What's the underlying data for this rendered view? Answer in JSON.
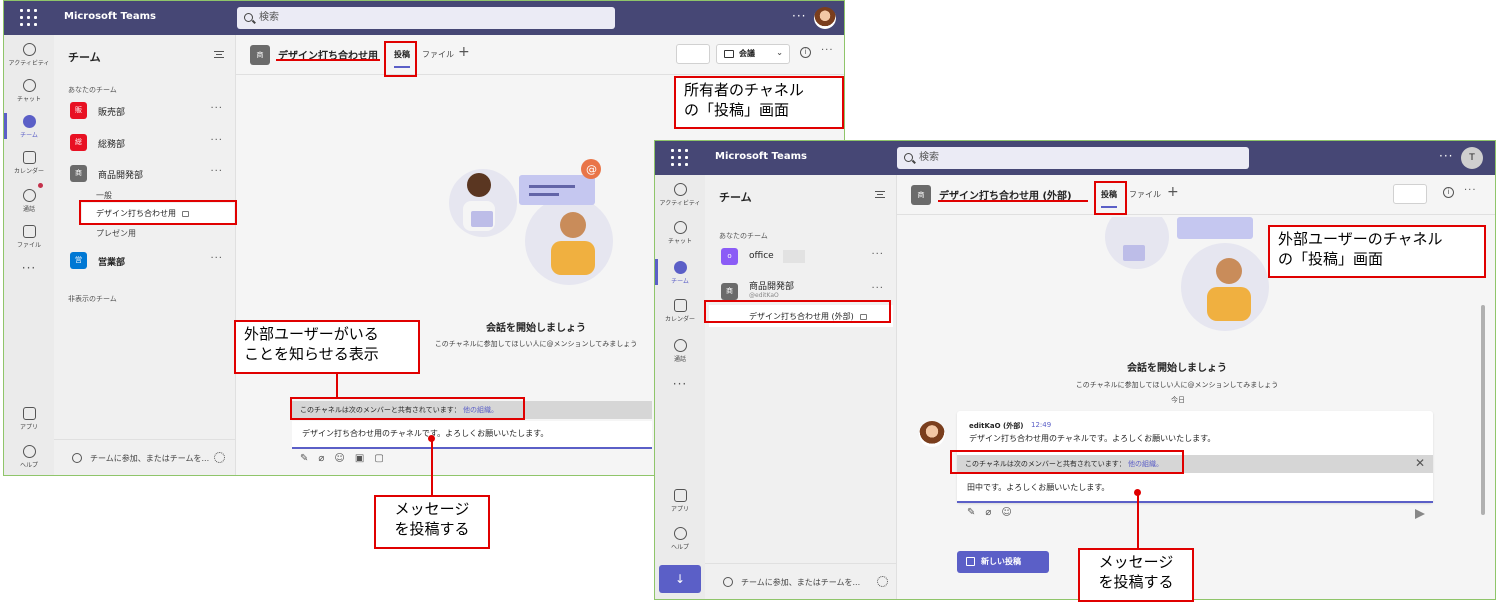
{
  "colors": {
    "titlebar": "#464775",
    "accent": "#5b5fc7",
    "callout_border": "#e00000",
    "window_border": "#8fc56a"
  },
  "win1": {
    "app_name": "Microsoft Teams",
    "search_placeholder": "検索",
    "more": "···",
    "rail": [
      {
        "label": "アクティビティ",
        "icon": "bell-icon"
      },
      {
        "label": "チャット",
        "icon": "chat-icon"
      },
      {
        "label": "チーム",
        "icon": "teams-icon"
      },
      {
        "label": "カレンダー",
        "icon": "calendar-icon"
      },
      {
        "label": "通話",
        "icon": "phone-icon"
      },
      {
        "label": "ファイル",
        "icon": "file-icon"
      },
      {
        "label": "···",
        "icon": "more-icon"
      },
      {
        "label": "アプリ",
        "icon": "apps-icon"
      },
      {
        "label": "ヘルプ",
        "icon": "help-icon"
      }
    ],
    "panel_title": "チーム",
    "your_teams_label": "あなたのチーム",
    "teams": [
      {
        "tile": "販",
        "name": "販売部",
        "color": "#e81123"
      },
      {
        "tile": "総",
        "name": "総務部",
        "color": "#e81123"
      },
      {
        "tile": "商",
        "name": "商品開発部",
        "color": "#6b6b6b"
      },
      {
        "tile": "営",
        "name": "営業部",
        "color": "#0078d4"
      }
    ],
    "channels": [
      "一般",
      "デザイン打ち合わせ用",
      "プレゼン用"
    ],
    "hidden_teams_label": "非表示のチーム",
    "footer_text": "チームに参加、またはチームを...",
    "channel_tile": "商",
    "channel_title": "デザイン打ち合わせ用",
    "tab_posts": "投稿",
    "tab_files": "ファイル",
    "plus": "+",
    "meet_label": "会議",
    "chevron": "⌄",
    "info": "i",
    "empty_title": "会話を開始しましょう",
    "empty_sub": "このチャネルに参加してほしい人に@メンションしてみましょう",
    "notice_text": "このチャネルは次のメンバーと共有されています：",
    "notice_link": "他の組織。",
    "compose_text": "デザイン打ち合わせ用のチャネルです。よろしくお願いいたします。"
  },
  "win2": {
    "app_name": "Microsoft Teams",
    "search_placeholder": "検索",
    "more": "···",
    "avatar_letter": "T",
    "rail": [
      {
        "label": "アクティビティ",
        "icon": "bell-icon"
      },
      {
        "label": "チャット",
        "icon": "chat-icon"
      },
      {
        "label": "チーム",
        "icon": "teams-icon"
      },
      {
        "label": "カレンダー",
        "icon": "calendar-icon"
      },
      {
        "label": "通話",
        "icon": "phone-icon"
      },
      {
        "label": "···",
        "icon": "more-icon"
      },
      {
        "label": "アプリ",
        "icon": "apps-icon"
      },
      {
        "label": "ヘルプ",
        "icon": "help-icon"
      }
    ],
    "panel_title": "チーム",
    "your_teams_label": "あなたのチーム",
    "teams": [
      {
        "tile": "o",
        "name": "office",
        "color": "#8b5cf6",
        "handle": ""
      },
      {
        "tile": "商",
        "name": "商品開発部",
        "color": "#6b6b6b",
        "handle": "@editKaO"
      }
    ],
    "channels": [
      "デザイン打ち合わせ用 (外部)"
    ],
    "footer_text": "チームに参加、またはチームを...",
    "channel_tile": "商",
    "channel_title": "デザイン打ち合わせ用 (外部)",
    "tab_posts": "投稿",
    "tab_files": "ファイル",
    "plus": "+",
    "info": "i",
    "empty_title": "会話を開始しましょう",
    "empty_sub": "このチャネルに参加してほしい人に@メンションしてみましょう",
    "today": "今日",
    "msg_author": "editKaO (外部)",
    "msg_time": "12:49",
    "msg_text": "デザイン打ち合わせ用のチャネルです。よろしくお願いいたします。",
    "notice_text": "このチャネルは次のメンバーと共有されています：",
    "notice_link": "他の組織。",
    "close": "✕",
    "compose_text": "田中です。よろしくお願いいたします。",
    "new_post": "新しい投稿"
  },
  "callouts": {
    "owner_line1": "所有者のチャネル",
    "owner_line2": "の「投稿」画面",
    "external_line1": "外部ユーザーのチャネル",
    "external_line2": "の「投稿」画面",
    "indicator_line1": "外部ユーザーがいる",
    "indicator_line2": "ことを知らせる表示",
    "post1_line1": "メッセージ",
    "post1_line2": "を投稿する",
    "post2_line1": "メッセージ",
    "post2_line2": "を投稿する"
  }
}
